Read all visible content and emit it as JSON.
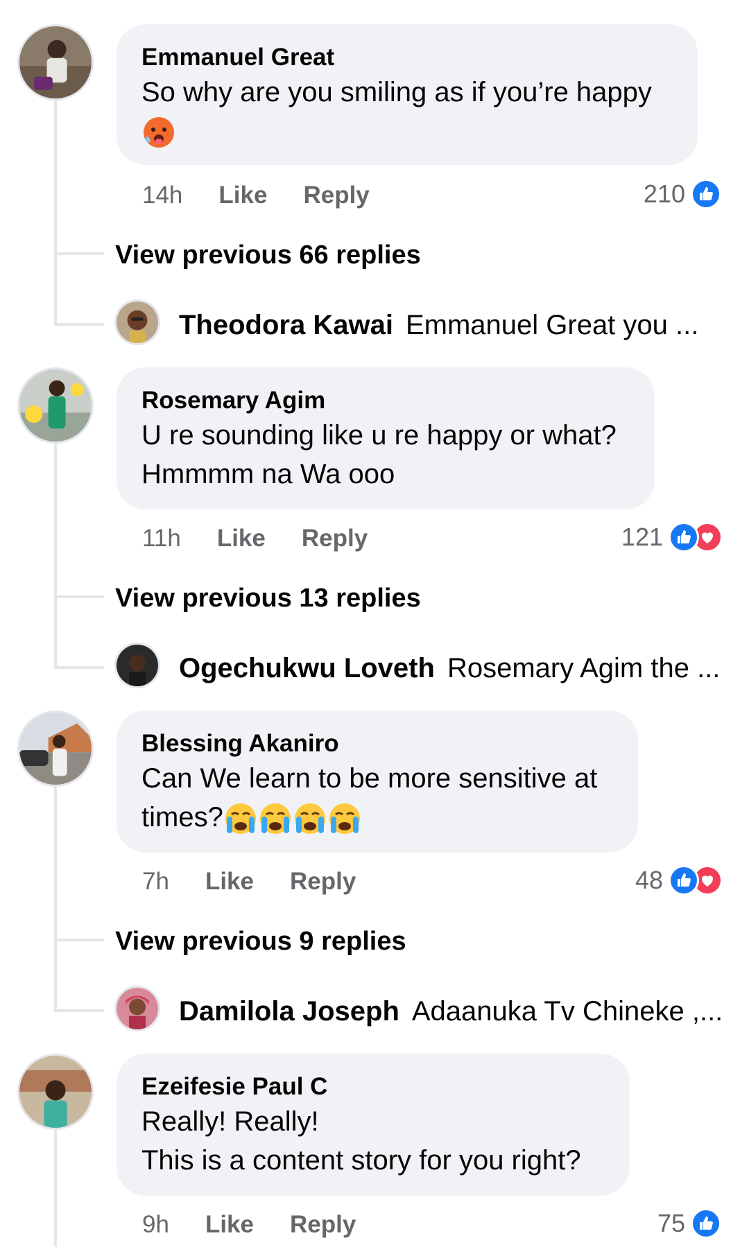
{
  "comments": [
    {
      "author": "Emmanuel Great",
      "lines": [
        "So why are you smiling as if you’re happy"
      ],
      "emoji_line": "hot-face-emoji",
      "time": "14h",
      "like_label": "Like",
      "reply_label": "Reply",
      "reaction_count": "210",
      "reactions": [
        "like"
      ],
      "view_previous": "View previous 66 replies",
      "latest_reply": {
        "name": "Theodora Kawai",
        "text": "Emmanuel Great you ..."
      }
    },
    {
      "author": "Rosemary Agim",
      "lines": [
        "U re sounding like u re happy or what?",
        "Hmmmm na Wa ooo"
      ],
      "time": "11h",
      "like_label": "Like",
      "reply_label": "Reply",
      "reaction_count": "121",
      "reactions": [
        "like",
        "love"
      ],
      "view_previous": "View previous 13 replies",
      "latest_reply": {
        "name": "Ogechukwu Loveth",
        "text": "Rosemary Agim the ..."
      }
    },
    {
      "author": "Blessing Akaniro",
      "lines": [
        "Can We learn to be more sensitive at",
        "times?"
      ],
      "emoji_after_last_line": [
        "crying-face-emoji",
        "crying-face-emoji",
        "crying-face-emoji",
        "crying-face-emoji"
      ],
      "time": "7h",
      "like_label": "Like",
      "reply_label": "Reply",
      "reaction_count": "48",
      "reactions": [
        "like",
        "love"
      ],
      "view_previous": "View previous 9 replies",
      "latest_reply": {
        "name": "Damilola Joseph",
        "text": "Adaanuka Tv Chineke ,..."
      }
    },
    {
      "author": "Ezeifesie Paul C",
      "lines": [
        "Really! Really!",
        "This is a content story for you right?"
      ],
      "time": "9h",
      "like_label": "Like",
      "reply_label": "Reply",
      "reaction_count": "75",
      "reactions": [
        "like"
      ]
    }
  ],
  "colors": {
    "bubble": "#f0f2f5",
    "meta_text": "#65676b",
    "like_blue": "#1877f2",
    "love_red": "#f33e58",
    "thread_line": "#e4e6eb"
  }
}
